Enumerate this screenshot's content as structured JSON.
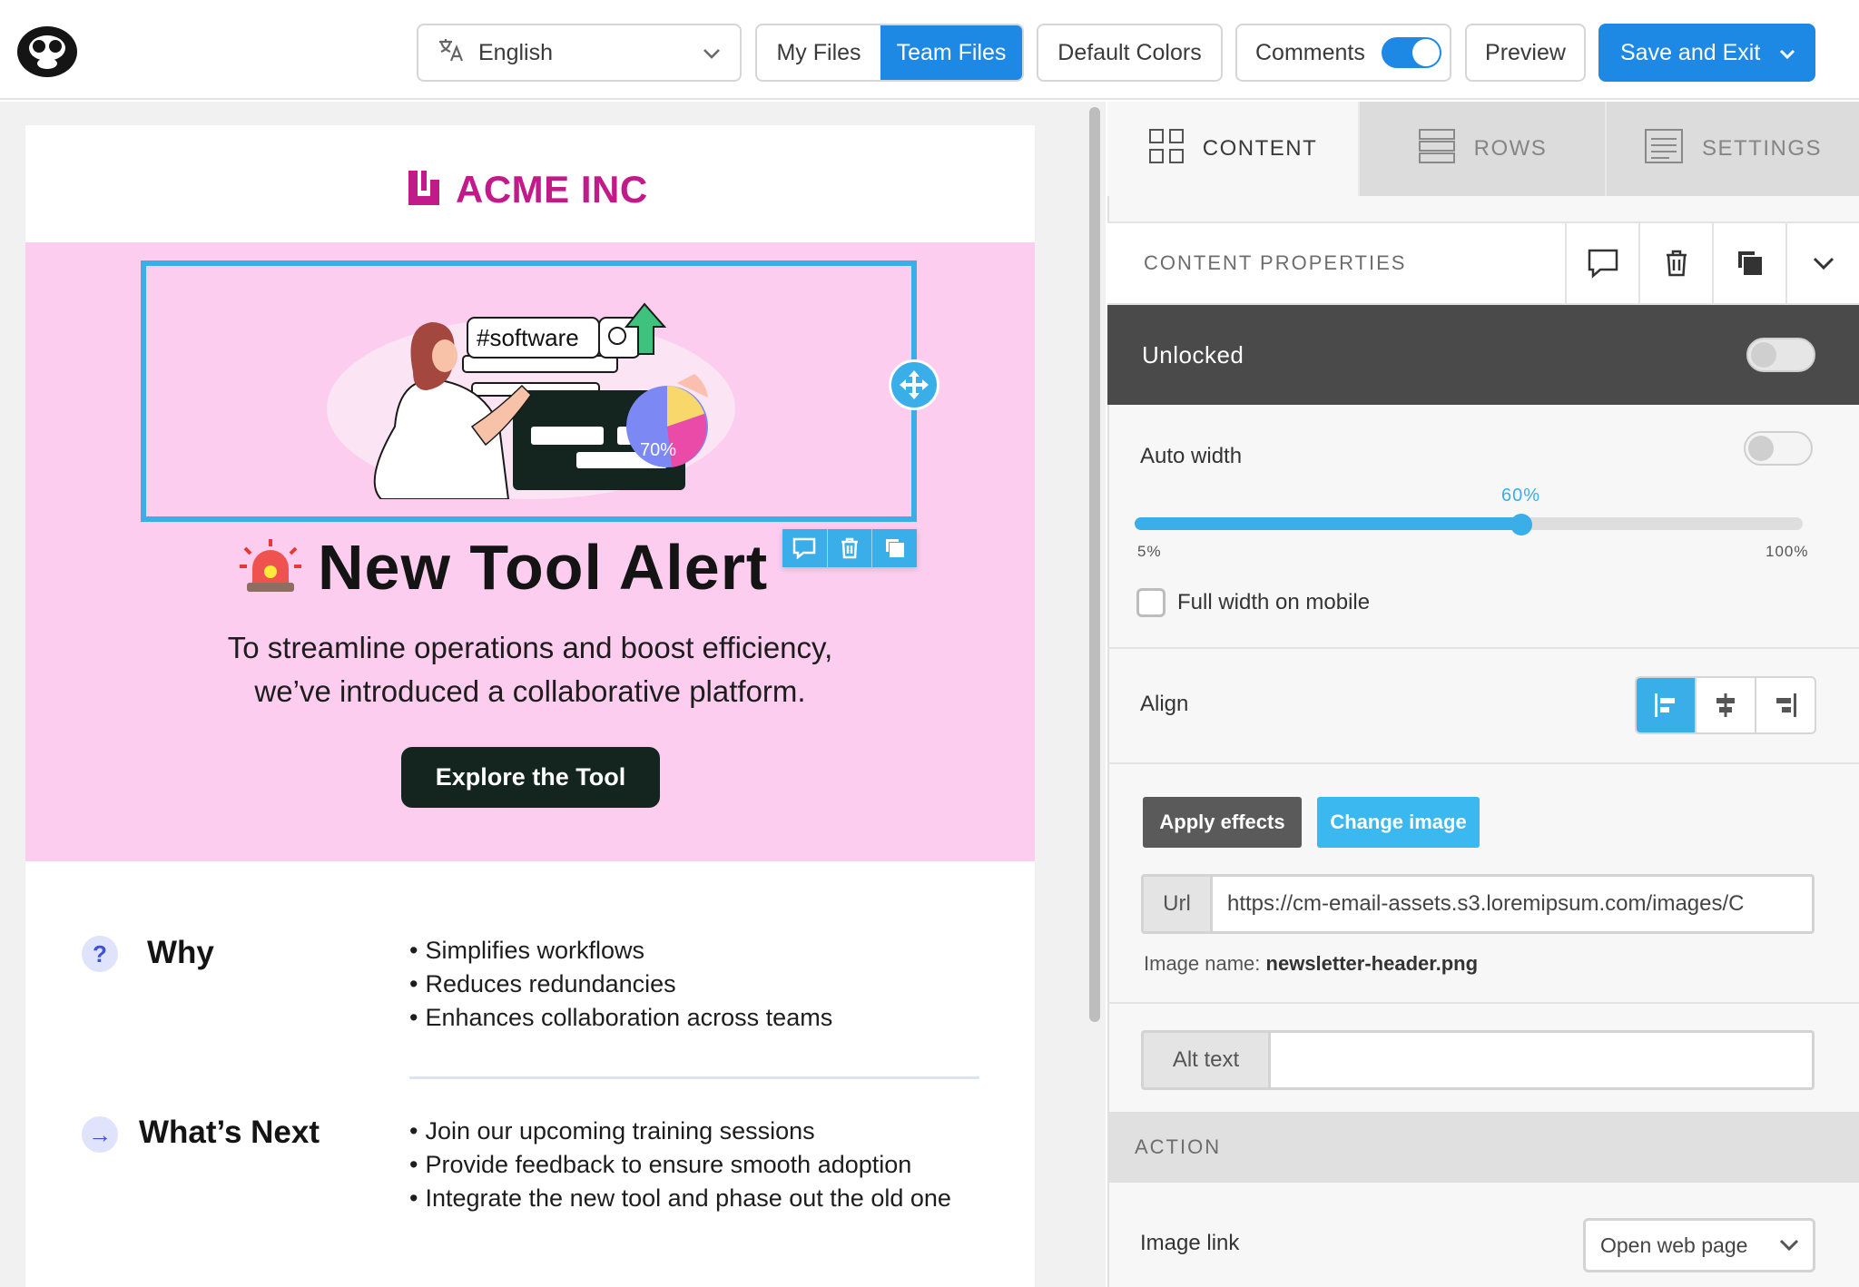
{
  "topbar": {
    "language": "English",
    "my_files": "My Files",
    "team_files": "Team Files",
    "default_colors": "Default Colors",
    "comments": "Comments",
    "comments_enabled": true,
    "preview": "Preview",
    "save_and_exit": "Save and Exit"
  },
  "email": {
    "brand": "ACME INC",
    "hero_image_text": {
      "search_tag": "#software",
      "chart_percent": "70%"
    },
    "headline": "New Tool Alert",
    "subcopy_line1": "To streamline operations and boost efficiency,",
    "subcopy_line2": "we’ve introduced a collaborative platform.",
    "cta": "Explore the Tool",
    "why": {
      "icon": "?",
      "title": "Why",
      "items": [
        "Simplifies workflows",
        "Reduces redundancies",
        "Enhances collaboration across teams"
      ]
    },
    "next": {
      "icon": "→",
      "title": "What’s Next",
      "items": [
        "Join our upcoming training sessions",
        "Provide feedback to ensure smooth adoption",
        "Integrate the new tool and phase out the old one"
      ]
    },
    "colors": {
      "hero_bg": "#fccdee",
      "brand": "#c2198b",
      "cta_bg": "#14251f"
    }
  },
  "panel": {
    "tabs": [
      {
        "label": "CONTENT",
        "icon": "grid-icon",
        "active": true
      },
      {
        "label": "ROWS",
        "icon": "rows-icon",
        "active": false
      },
      {
        "label": "SETTINGS",
        "icon": "settings-list-icon",
        "active": false
      }
    ],
    "content_properties": "CONTENT  PROPERTIES",
    "locked_label": "Unlocked",
    "auto_width": {
      "label": "Auto width",
      "enabled": false
    },
    "width_slider": {
      "value": "60%",
      "value_num": 60,
      "min": "5%",
      "max": "100%",
      "min_num": 5,
      "max_num": 100
    },
    "full_width_mobile": "Full width on mobile",
    "align": {
      "label": "Align",
      "selected": "left"
    },
    "apply_effects": "Apply effects",
    "change_image": "Change image",
    "url": {
      "prefix": "Url",
      "value": "https://cm-email-assets.s3.loremipsum.com/images/C"
    },
    "image_name_label": "Image name:",
    "image_name": "newsletter-header.png",
    "alt_text": {
      "prefix": "Alt text",
      "value": ""
    },
    "action_header": "ACTION",
    "image_link": {
      "label": "Image link",
      "selected": "Open web page"
    },
    "accent": "#3aaee8"
  }
}
